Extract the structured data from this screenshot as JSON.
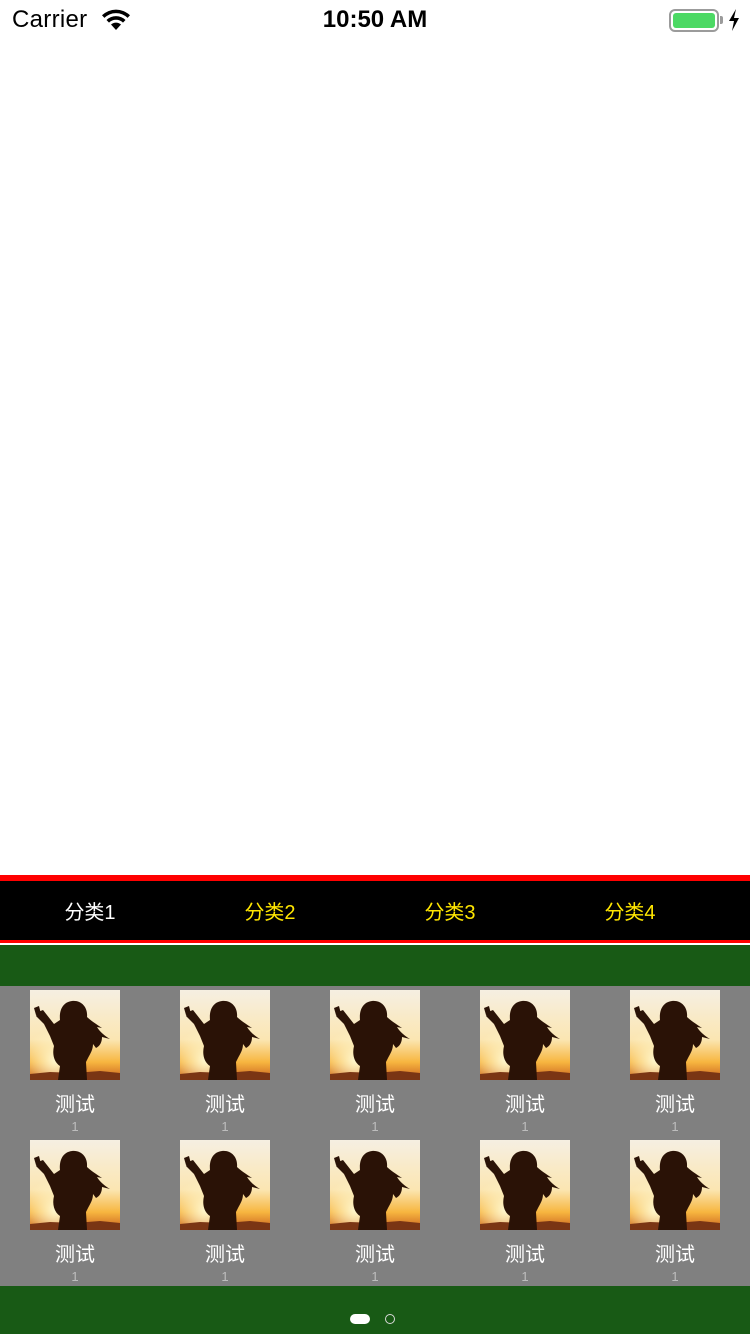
{
  "status_bar": {
    "carrier": "Carrier",
    "time": "10:50 AM",
    "battery_color": "#4cd964"
  },
  "tab_bar": {
    "tabs": [
      {
        "label": "分类1",
        "selected": true
      },
      {
        "label": "分类2",
        "selected": false
      },
      {
        "label": "分类3",
        "selected": false
      },
      {
        "label": "分类4",
        "selected": false
      }
    ],
    "selected_color": "#ffffff",
    "unselected_color": "#ffe600",
    "accent_line_color": "#ff0000"
  },
  "grid": {
    "items": [
      {
        "title": "测试",
        "count": "1",
        "icon": "silhouette-photo"
      },
      {
        "title": "测试",
        "count": "1",
        "icon": "silhouette-photo"
      },
      {
        "title": "测试",
        "count": "1",
        "icon": "silhouette-photo"
      },
      {
        "title": "测试",
        "count": "1",
        "icon": "silhouette-photo"
      },
      {
        "title": "测试",
        "count": "1",
        "icon": "silhouette-photo"
      },
      {
        "title": "测试",
        "count": "1",
        "icon": "silhouette-photo"
      },
      {
        "title": "测试",
        "count": "1",
        "icon": "silhouette-photo"
      },
      {
        "title": "测试",
        "count": "1",
        "icon": "silhouette-photo"
      },
      {
        "title": "测试",
        "count": "1",
        "icon": "silhouette-photo"
      },
      {
        "title": "测试",
        "count": "1",
        "icon": "silhouette-photo"
      }
    ],
    "background_color": "#808080"
  },
  "pager": {
    "page_count": 2,
    "current_page": 1,
    "band_color": "#185a15"
  }
}
